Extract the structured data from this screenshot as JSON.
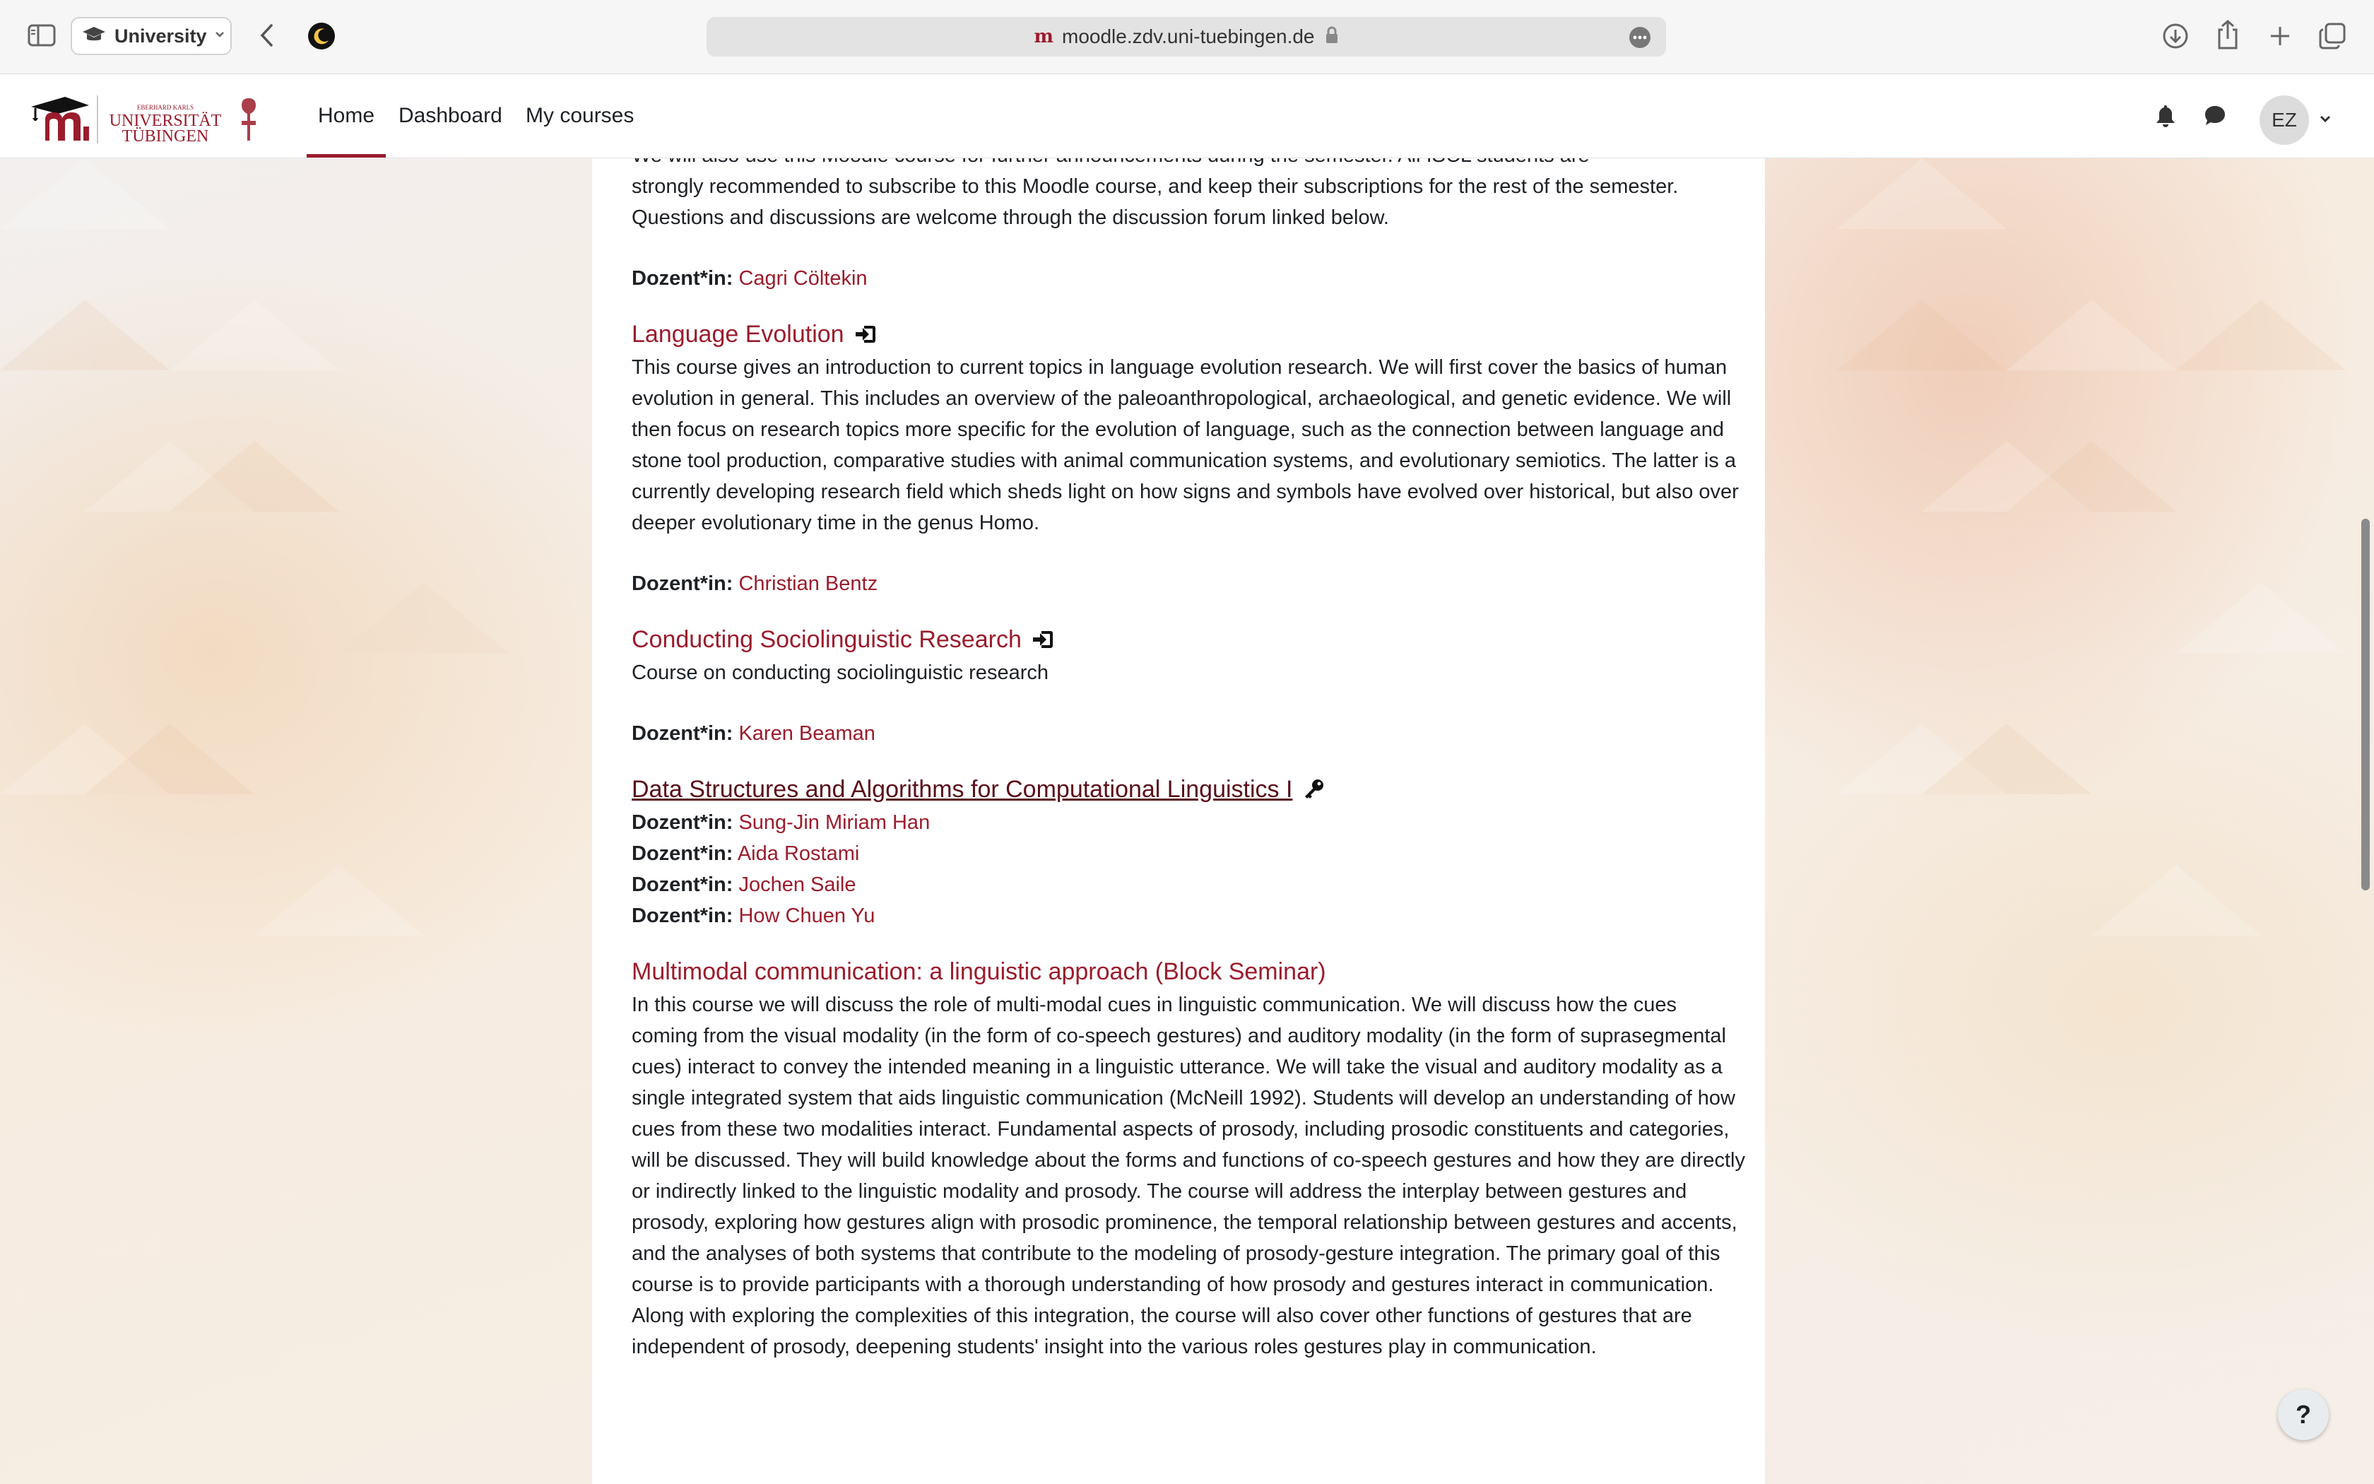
{
  "browser": {
    "profile_label": "University",
    "url": "moodle.zdv.uni-tuebingen.de",
    "favicon": "m"
  },
  "navbar": {
    "logo_text_small": "EBERHARD KARLS",
    "logo_text_line1": "UNIVERSITÄT",
    "logo_text_line2": "TÜBINGEN",
    "items": [
      {
        "label": "Home",
        "active": true
      },
      {
        "label": "Dashboard",
        "active": false
      },
      {
        "label": "My courses",
        "active": false
      }
    ],
    "user_initials": "EZ"
  },
  "intro": {
    "partial_line": "We will also use this Moodle course for further announcements during the semester. All ISCL students are",
    "text": "strongly recommended to subscribe to this Moodle course, and keep their subscriptions for the rest of the semester. Questions and discussions are welcome through the discussion forum linked below.",
    "teacher_label": "Dozent*in:",
    "teacher": "Cagri Cöltekin"
  },
  "courses": [
    {
      "title": "Language Evolution",
      "icon": "enrol-icon",
      "summary": "This course gives an introduction to current topics in language evolution research. We will first cover the basics of human evolution in general. This includes an overview of the paleoanthropological, archaeological, and genetic evidence. We will then focus on research topics more specific for the evolution of language, such as the connection between language and stone tool production, comparative studies with animal communication systems, and evolutionary semiotics. The latter is a currently developing research field which sheds light on how signs and symbols have evolved over historical, but also over deeper evolutionary time in the genus Homo.",
      "teachers": [
        "Christian Bentz"
      ]
    },
    {
      "title": "Conducting Sociolinguistic Research",
      "icon": "enrol-icon",
      "summary": "Course on conducting sociolinguistic research",
      "teachers": [
        "Karen Beaman"
      ]
    },
    {
      "title": "Data Structures and Algorithms for Computational Linguistics I",
      "icon": "key-icon",
      "summary": "",
      "teachers": [
        "Sung-Jin Miriam Han",
        "Aida Rostami",
        "Jochen Saile",
        "How Chuen Yu"
      ]
    },
    {
      "title": "Multimodal communication: a linguistic approach (Block Seminar)",
      "icon": "",
      "summary": "In this course we will discuss the role of multi-modal cues in linguistic communication. We will discuss how the cues coming from the visual modality (in the form of co-speech gestures) and auditory modality (in the form of suprasegmental cues) interact to convey the intended meaning in a linguistic utterance. We will take the visual and auditory modality as a single integrated system that aids linguistic communication (McNeill 1992). Students will develop an understanding of how cues from these two modalities interact. Fundamental aspects of prosody, including prosodic constituents and categories, will be discussed. They will build knowledge about the forms and functions of co-speech gestures and how they are directly or indirectly linked to the linguistic modality and prosody.  The course will address the interplay between gestures and prosody, exploring how gestures align with prosodic prominence, the temporal relationship between gestures and accents, and the analyses of both systems that contribute to the modeling of prosody-gesture integration. The primary goal of this course is to provide participants with a thorough understanding of how prosody and gestures interact in communication. Along with exploring the complexities of this integration, the course will also cover other functions of gestures that are independent of prosody, deepening students' insight into the various roles gestures play in communication.",
      "teachers": []
    }
  ],
  "help_label": "?",
  "colors": {
    "brand": "#9b1c2c",
    "text": "#1d2125"
  }
}
